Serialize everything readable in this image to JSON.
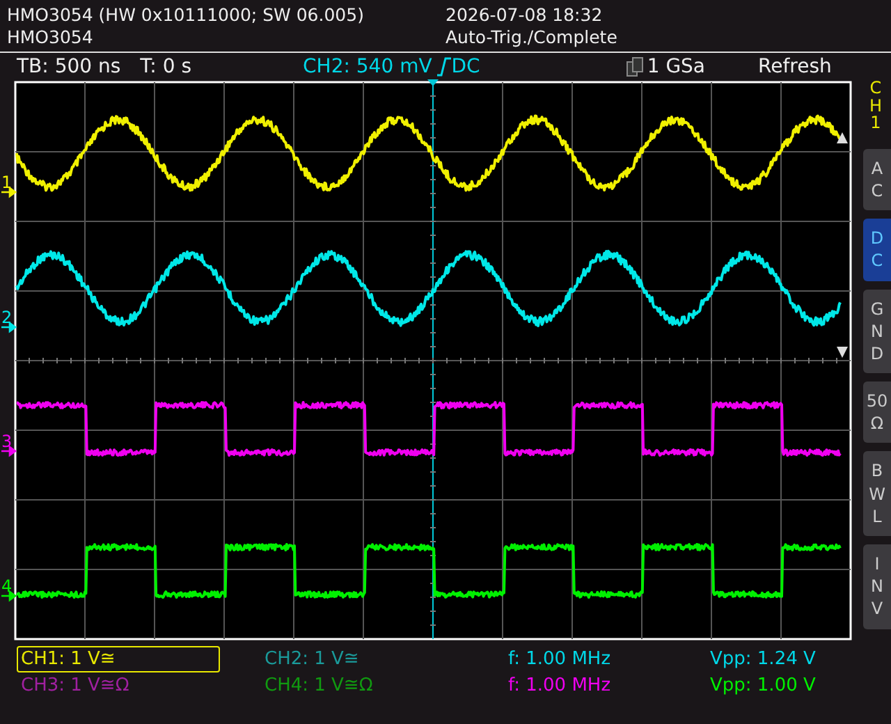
{
  "header": {
    "title": "HMO3054 (HW 0x10111000; SW 06.005)",
    "subtitle": "HMO3054",
    "datetime": "2026-07-08 18:32",
    "status": "Auto-Trig./Complete"
  },
  "toolbar": {
    "timebase": "TB: 500 ns",
    "trigger_time": "T: 0 s",
    "trigger_source": "CH2: 540 mV",
    "trigger_coupling": "DC",
    "sample_rate": "1 GSa",
    "mode": "Refresh"
  },
  "traces": [
    {
      "marker": "1",
      "kind": "sine",
      "color": "#f0f000"
    },
    {
      "marker": "2",
      "kind": "sine",
      "color": "#00e8e8"
    },
    {
      "marker": "3",
      "kind": "square",
      "color": "#f000f0"
    },
    {
      "marker": "4",
      "kind": "square",
      "color": "#00f000"
    }
  ],
  "side_menu": {
    "channel": "CH1",
    "buttons": [
      {
        "label": "AC",
        "selected": false
      },
      {
        "label": "DC",
        "selected": true
      },
      {
        "label": "GND",
        "selected": false
      },
      {
        "label": "50 Ω",
        "selected": false
      },
      {
        "label": "BWL",
        "selected": false
      },
      {
        "label": "INV",
        "selected": false
      }
    ]
  },
  "channel_settings": [
    {
      "label": "CH1: 1 V≅",
      "selected": true,
      "color": "#e8e800"
    },
    {
      "label": "CH2: 1 V≅",
      "selected": false,
      "color": "#1a9a9a"
    },
    {
      "label": "CH3: 1 V≅Ω",
      "selected": false,
      "color": "#a020a0"
    },
    {
      "label": "CH4: 1 V≅Ω",
      "selected": false,
      "color": "#109a10"
    }
  ],
  "measurements": [
    {
      "label": "f: 1.00 MHz",
      "color": "#00d8e8"
    },
    {
      "label": "Vpp: 1.24 V",
      "color": "#00d8e8"
    },
    {
      "label": "f: 1.00 MHz",
      "color": "#f000f0"
    },
    {
      "label": "Vpp: 1.00 V",
      "color": "#00f000"
    }
  ]
}
